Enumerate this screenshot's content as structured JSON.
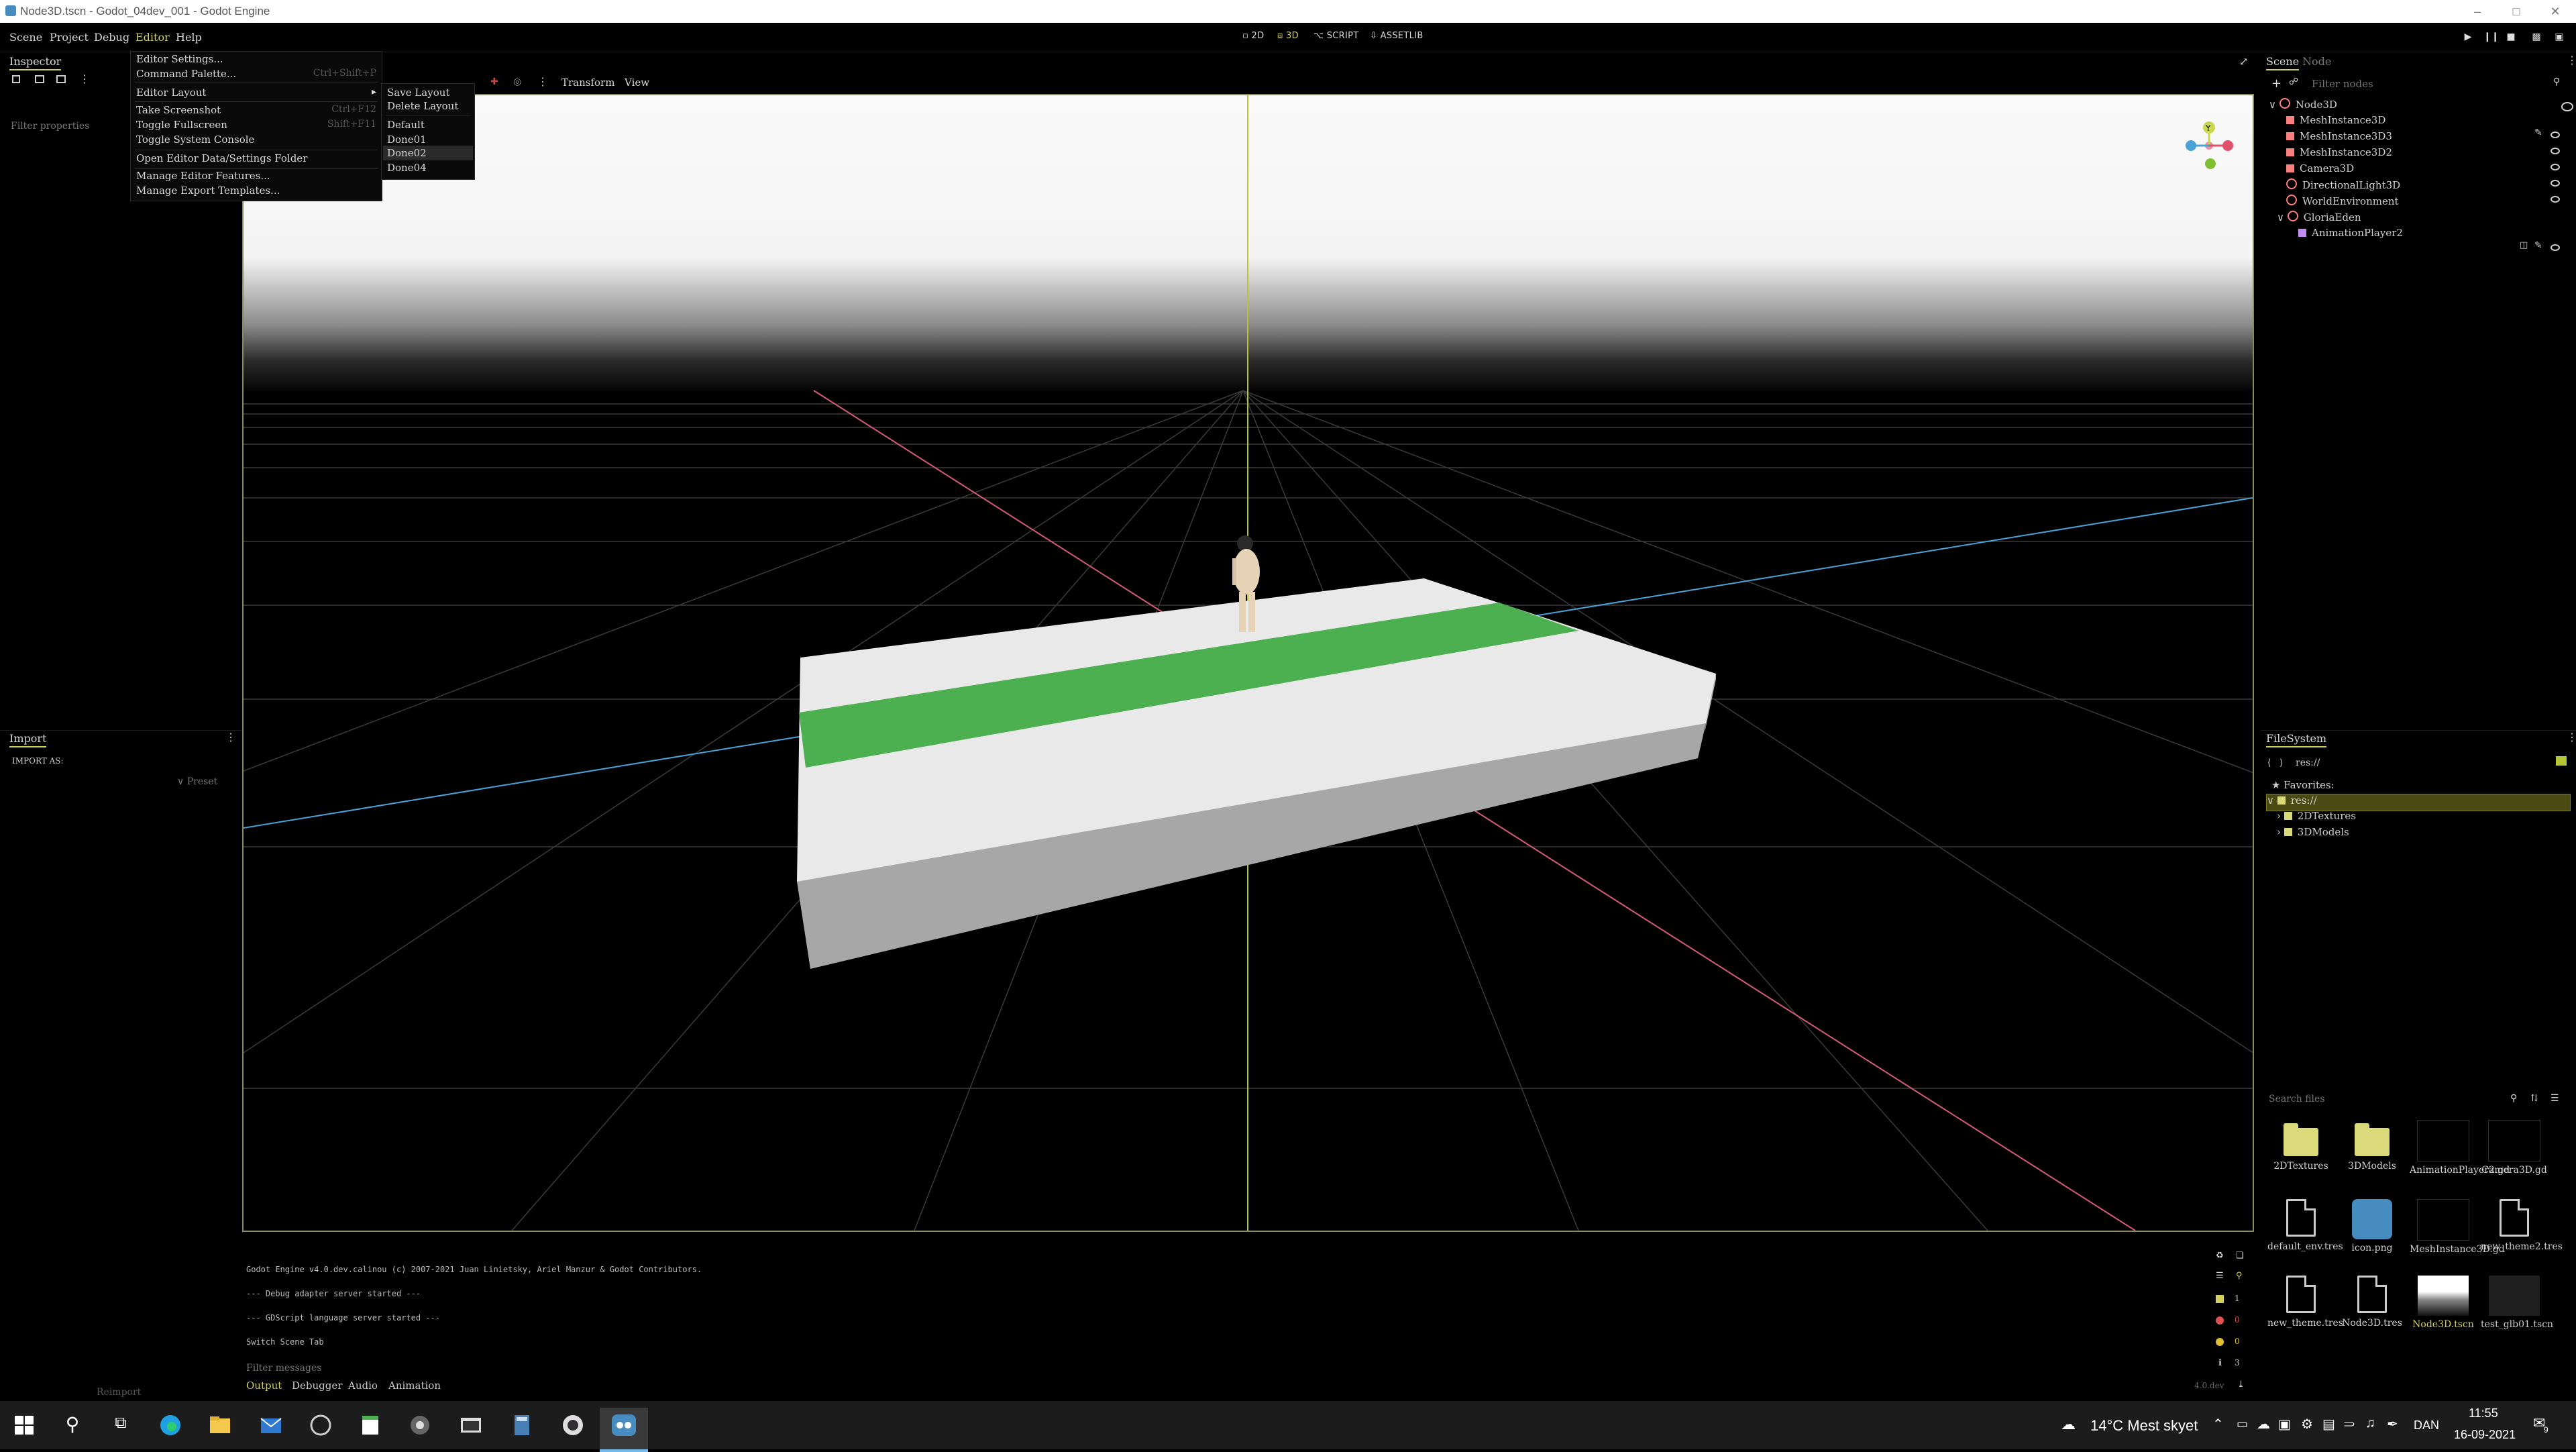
{
  "window": {
    "title": "Node3D.tscn - Godot_04dev_001 - Godot Engine"
  },
  "menubar": {
    "menus": [
      "Scene",
      "Project",
      "Debug",
      "Editor",
      "Help"
    ],
    "modes": [
      "2D",
      "3D",
      "SCRIPT",
      "ASSETLIB"
    ]
  },
  "editor_menu": {
    "items": [
      {
        "label": "Editor Settings...",
        "shortcut": ""
      },
      {
        "label": "Command Palette...",
        "shortcut": "Ctrl+Shift+P"
      },
      {
        "label": "Editor Layout",
        "shortcut": ""
      },
      {
        "label": "Take Screenshot",
        "shortcut": "Ctrl+F12"
      },
      {
        "label": "Toggle Fullscreen",
        "shortcut": "Shift+F11"
      },
      {
        "label": "Toggle System Console",
        "shortcut": ""
      },
      {
        "label": "Open Editor Data/Settings Folder",
        "shortcut": ""
      },
      {
        "label": "Manage Editor Features...",
        "shortcut": ""
      },
      {
        "label": "Manage Export Templates...",
        "shortcut": ""
      }
    ],
    "layout_submenu": [
      "Save Layout",
      "Delete Layout",
      "Default",
      "Done01",
      "Done02",
      "Done04"
    ],
    "highlighted": "Done02"
  },
  "inspector": {
    "tab": "Inspector",
    "filter_placeholder": "Filter properties"
  },
  "import_panel": {
    "tab": "Import",
    "import_as": "IMPORT AS:",
    "preset": "Preset",
    "reimport": "Reimport"
  },
  "viewport": {
    "toolbar": {
      "transform": "Transform",
      "view": "View"
    },
    "gizmo_axis": "Y"
  },
  "scene_panel": {
    "tabs": [
      "Scene",
      "Node"
    ],
    "filter_placeholder": "Filter nodes",
    "nodes": [
      {
        "name": "Node3D",
        "depth": 0,
        "icon_color": "#fc7f7f"
      },
      {
        "name": "MeshInstance3D",
        "depth": 1,
        "icon_color": "#fc7f7f"
      },
      {
        "name": "MeshInstance3D3",
        "depth": 1,
        "icon_color": "#fc7f7f"
      },
      {
        "name": "MeshInstance3D2",
        "depth": 1,
        "icon_color": "#fc7f7f"
      },
      {
        "name": "Camera3D",
        "depth": 1,
        "icon_color": "#fc7f7f"
      },
      {
        "name": "DirectionalLight3D",
        "depth": 1,
        "icon_color": "#fc7f7f"
      },
      {
        "name": "WorldEnvironment",
        "depth": 1,
        "icon_color": "#fc7f7f"
      },
      {
        "name": "GloriaEden",
        "depth": 1,
        "icon_color": "#fc7f7f"
      },
      {
        "name": "AnimationPlayer2",
        "depth": 2,
        "icon_color": "#c38ef1"
      }
    ]
  },
  "filesystem": {
    "tab": "FileSystem",
    "path": "res://",
    "tree": [
      "Favorites:",
      "res://",
      "2DTextures",
      "3DModels"
    ],
    "search_placeholder": "Search files",
    "files": [
      {
        "name": "2DTextures",
        "kind": "folder"
      },
      {
        "name": "3DModels",
        "kind": "folder"
      },
      {
        "name": "AnimationPlayer2.gd",
        "kind": "script"
      },
      {
        "name": "Camera3D.gd",
        "kind": "script"
      },
      {
        "name": "default_env.tres",
        "kind": "file"
      },
      {
        "name": "icon.png",
        "kind": "godot"
      },
      {
        "name": "MeshInstance3D.gd",
        "kind": "script"
      },
      {
        "name": "new_theme2.tres",
        "kind": "file"
      },
      {
        "name": "new_theme.tres",
        "kind": "file"
      },
      {
        "name": "Node3D.tres",
        "kind": "file"
      },
      {
        "name": "Node3D.tscn",
        "kind": "scene"
      },
      {
        "name": "test_glb01.tscn",
        "kind": "dark"
      }
    ]
  },
  "output": {
    "lines": [
      "Godot Engine v4.0.dev.calinou (c) 2007-2021 Juan Linietsky, Ariel Manzur & Godot Contributors.",
      "--- Debug adapter server started ---",
      "--- GDScript language server started ---",
      "Switch Scene Tab"
    ],
    "filter_placeholder": "Filter messages",
    "tabs": [
      "Output",
      "Debugger",
      "Audio",
      "Animation"
    ],
    "counts": [
      "1",
      "0",
      "0",
      "3"
    ],
    "version": "4.0.dev"
  },
  "taskbar": {
    "weather": "14°C  Mest skyet",
    "language": "DAN",
    "time": "11:55",
    "date": "16-09-2021",
    "notifications": "9"
  },
  "colors": {
    "accent": "#d0d060",
    "green_strip": "#4caf50",
    "axis_red": "#d65a7a",
    "axis_blue": "#4aa3d8",
    "axis_green": "#b6c43a"
  }
}
